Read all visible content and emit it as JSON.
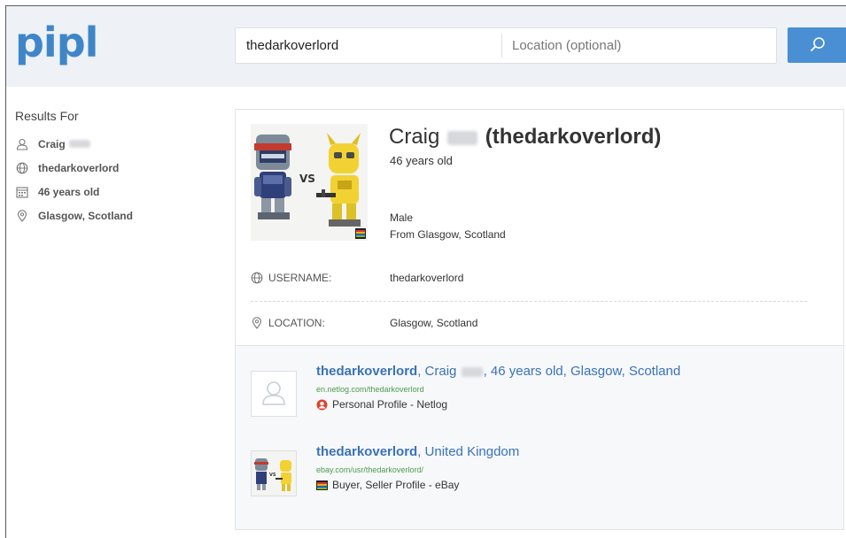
{
  "header": {
    "logo": "pipl",
    "search_value": "thedarkoverlord",
    "location_placeholder": "Location (optional)"
  },
  "sidebar": {
    "title": "Results For",
    "items": [
      {
        "icon": "person-icon",
        "label": "Craig"
      },
      {
        "icon": "globe-icon",
        "label": "thedarkoverlord"
      },
      {
        "icon": "calendar-icon",
        "label": "46 years old"
      },
      {
        "icon": "location-pin-icon",
        "label": "Glasgow, Scotland"
      }
    ]
  },
  "profile": {
    "first_name": "Craig",
    "username_paren": "(thedarkoverlord)",
    "age": "46 years old",
    "gender": "Male",
    "from": "From Glasgow, Scotland",
    "fields": [
      {
        "icon": "globe-icon",
        "label": "USERNAME:",
        "value": "thedarkoverlord"
      },
      {
        "icon": "location-pin-icon",
        "label": "LOCATION:",
        "value": "Glasgow, Scotland"
      }
    ]
  },
  "sources": [
    {
      "title_bold": "thedarkoverlord",
      "title_pre": ", Craig",
      "title_post": ", 46 years old, Glasgow, Scotland",
      "url": "en.netlog.com/thedarkoverlord",
      "type": "Personal Profile - Netlog",
      "type_icon": "netlog-icon"
    },
    {
      "title_bold": "thedarkoverlord",
      "title_rest": ", United Kingdom",
      "url": "ebay.com/usr/thedarkoverlord/",
      "type": "Buyer, Seller Profile - eBay",
      "type_icon": "ebay-icon"
    }
  ],
  "colors": {
    "accent": "#4a8fd4",
    "link": "#3b72b8",
    "url": "#4e9a4e",
    "header_bg": "#eef1f5"
  }
}
